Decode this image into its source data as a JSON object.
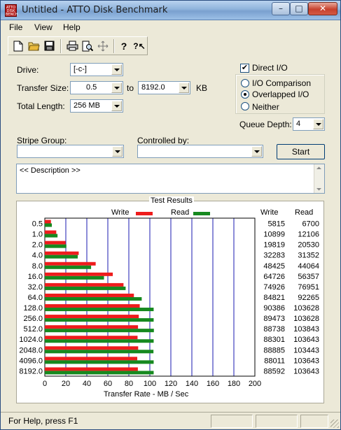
{
  "window": {
    "title": "Untitled - ATTO Disk Benchmark",
    "icon_text": "ATTO DISK BENCH",
    "minimize_glyph": "–",
    "maximize_glyph": "□",
    "close_glyph": "✕"
  },
  "menu": [
    "File",
    "View",
    "Help"
  ],
  "toolbar": {
    "buttons": [
      "new-file-icon",
      "open-folder-icon",
      "save-icon",
      "print-icon",
      "print-preview-icon",
      "move-icon",
      "help-icon",
      "context-help-icon"
    ],
    "glyphs": [
      "🗋",
      "📂",
      "💾",
      "🖨",
      "🔍",
      "✥",
      "?",
      "?↖"
    ]
  },
  "settings": {
    "drive_label": "Drive:",
    "drive_value": "[-c-]",
    "transfer_size_label": "Transfer Size:",
    "transfer_from": "0.5",
    "to_label": "to",
    "transfer_to": "8192.0",
    "kb_label": "KB",
    "total_length_label": "Total Length:",
    "total_length_value": "256 MB",
    "direct_io_label": "Direct I/O",
    "direct_io_checked": true,
    "io_options": [
      "I/O Comparison",
      "Overlapped I/O",
      "Neither"
    ],
    "io_selected": "Overlapped I/O",
    "queue_depth_label": "Queue Depth:",
    "queue_depth_value": "4",
    "stripe_group_label": "Stripe Group:",
    "stripe_group_value": "",
    "controlled_by_label": "Controlled by:",
    "controlled_by_value": "",
    "start_label": "Start",
    "description_text": "<< Description >>"
  },
  "results": {
    "title": "Test Results",
    "write_legend": "Write",
    "read_legend": "Read",
    "write_col": "Write",
    "read_col": "Read",
    "write_color": "#ee1c1c",
    "read_color": "#16891f",
    "axis_title": "Transfer Rate - MB / Sec"
  },
  "chart_data": {
    "type": "bar",
    "orientation": "horizontal",
    "categories": [
      "0.5",
      "1.0",
      "2.0",
      "4.0",
      "8.0",
      "16.0",
      "32.0",
      "64.0",
      "128.0",
      "256.0",
      "512.0",
      "1024.0",
      "2048.0",
      "4096.0",
      "8192.0"
    ],
    "series": [
      {
        "name": "Write",
        "values": [
          5815,
          10899,
          19819,
          32283,
          48425,
          64726,
          74926,
          84821,
          90386,
          89473,
          88738,
          88301,
          88885,
          88011,
          88592
        ]
      },
      {
        "name": "Read",
        "values": [
          6700,
          12106,
          20530,
          31352,
          44064,
          56357,
          76951,
          92265,
          103628,
          103628,
          103843,
          103643,
          103443,
          103643,
          103643
        ]
      }
    ],
    "xlabel": "Transfer Rate - MB / Sec",
    "xlim": [
      0,
      200
    ],
    "xticks": [
      0,
      20,
      40,
      60,
      80,
      100,
      120,
      140,
      160,
      180,
      200
    ],
    "value_unit": "KB/s",
    "grid": true
  },
  "status": {
    "text": "For Help, press F1"
  }
}
